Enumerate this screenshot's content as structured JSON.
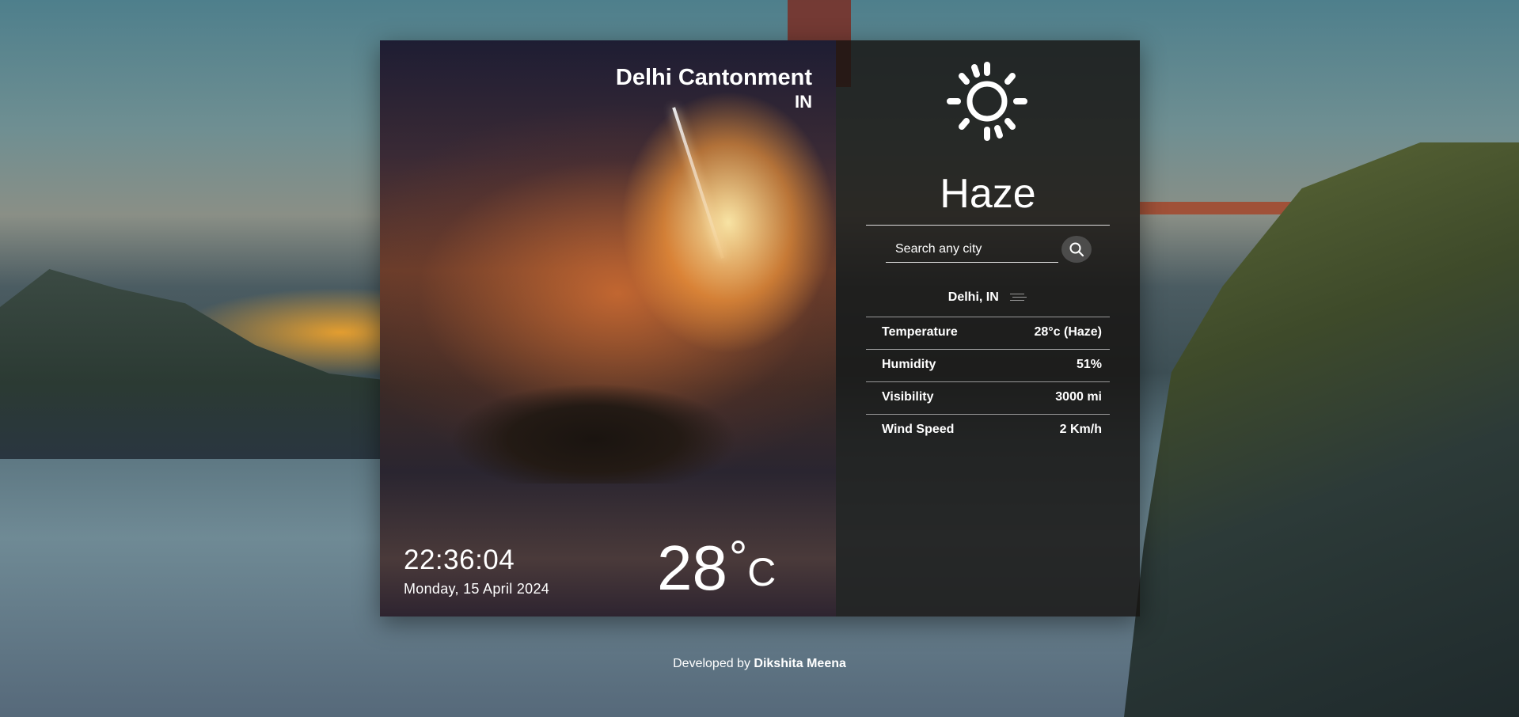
{
  "location": {
    "city": "Delhi Cantonment",
    "country": "IN"
  },
  "clock": {
    "time": "22:36:04",
    "date": "Monday, 15 April 2024"
  },
  "temperature": {
    "value": "28",
    "degree_symbol": "°",
    "unit": "C"
  },
  "conditions": {
    "icon": "sun-icon",
    "label": "Haze"
  },
  "search": {
    "placeholder": "Search any city",
    "value": "",
    "button_icon": "search-icon"
  },
  "details": {
    "location_label": "Delhi, IN",
    "location_icon": "haze-icon",
    "rows": [
      {
        "label": "Temperature",
        "value": "28°c (Haze)"
      },
      {
        "label": "Humidity",
        "value": "51%"
      },
      {
        "label": "Visibility",
        "value": "3000 mi"
      },
      {
        "label": "Wind Speed",
        "value": "2 Km/h"
      }
    ]
  },
  "footer": {
    "prefix": "Developed by",
    "author": "Dikshita Meena"
  }
}
